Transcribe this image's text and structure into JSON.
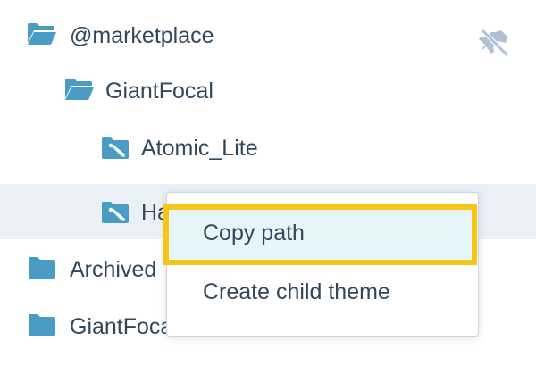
{
  "tree": {
    "items": [
      {
        "label": "@marketplace",
        "icon": "folder-open-icon",
        "level": 0
      },
      {
        "label": "GiantFocal",
        "icon": "folder-open-icon",
        "level": 1
      },
      {
        "label": "Atomic_Lite",
        "icon": "theme-folder-icon",
        "level": 2
      },
      {
        "label": "Ha",
        "icon": "theme-folder-icon",
        "level": 2,
        "selected": true
      },
      {
        "label": "Archived",
        "icon": "folder-icon",
        "level": 0
      },
      {
        "label": "GiantFocal",
        "icon": "folder-icon",
        "level": 0
      }
    ],
    "pin_icon": "unpin-icon"
  },
  "context_menu": {
    "items": [
      {
        "label": "Copy path",
        "highlighted": true
      },
      {
        "label": "Create child theme"
      }
    ]
  },
  "colors": {
    "folder": "#4a9cc4",
    "selected_row": "#eaf0f6",
    "menu_hover": "#e5f5f8",
    "highlight_outline": "#f5c518",
    "text": "#33475b",
    "pin_icon": "#b0c1d4"
  }
}
